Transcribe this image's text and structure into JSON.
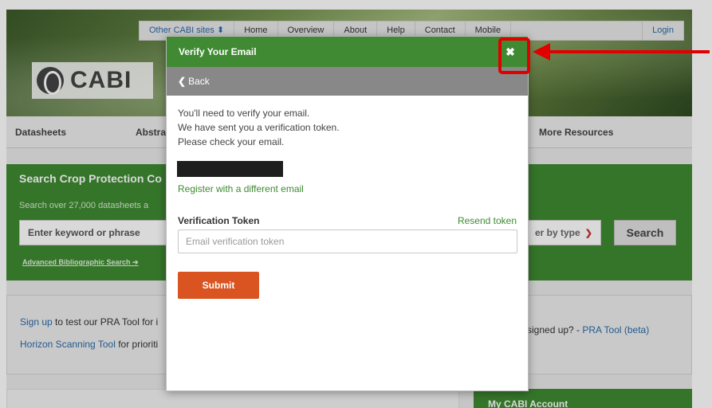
{
  "background": {
    "topnav": {
      "items": [
        "Other CABI sites  ⬍",
        "Home",
        "Overview",
        "About",
        "Help",
        "Contact",
        "Mobile"
      ],
      "login": "Login"
    },
    "logo_text": "CABI",
    "menu": {
      "datasheets": "Datasheets",
      "abstracts": "Abstra",
      "more_resources": "More Resources"
    },
    "search": {
      "title": "Search Crop Protection Co",
      "subtitle": "Search over 27,000 datasheets a",
      "keyword_placeholder": "Enter keyword or phrase",
      "advanced_link": "Advanced Bibliographic Search ➔",
      "filter_label": "er by type",
      "button": "Search"
    },
    "info": {
      "line1_link": "Sign up",
      "line1_text": " to test our PRA Tool for i",
      "line2_link": "Horizon Scanning Tool",
      "line2_text": " for prioriti",
      "right_text": "signed up? - ",
      "right_link": "PRA Tool (beta)"
    },
    "account_title": "My CABI Account"
  },
  "modal": {
    "title": "Verify Your Email",
    "close_icon": "close-icon",
    "back_label": "Back",
    "messages": [
      "You'll need to verify your email.",
      "We have sent you a verification token.",
      "Please check your email."
    ],
    "register_link": "Register with a different email",
    "token_label": "Verification Token",
    "resend_link": "Resend token",
    "token_placeholder": "Email verification token",
    "token_value": "",
    "submit_label": "Submit"
  },
  "colors": {
    "header_green": "#3f8a32",
    "submit_orange": "#d95420",
    "back_bar_gray": "#888888",
    "annotation_red": "#e00000"
  }
}
